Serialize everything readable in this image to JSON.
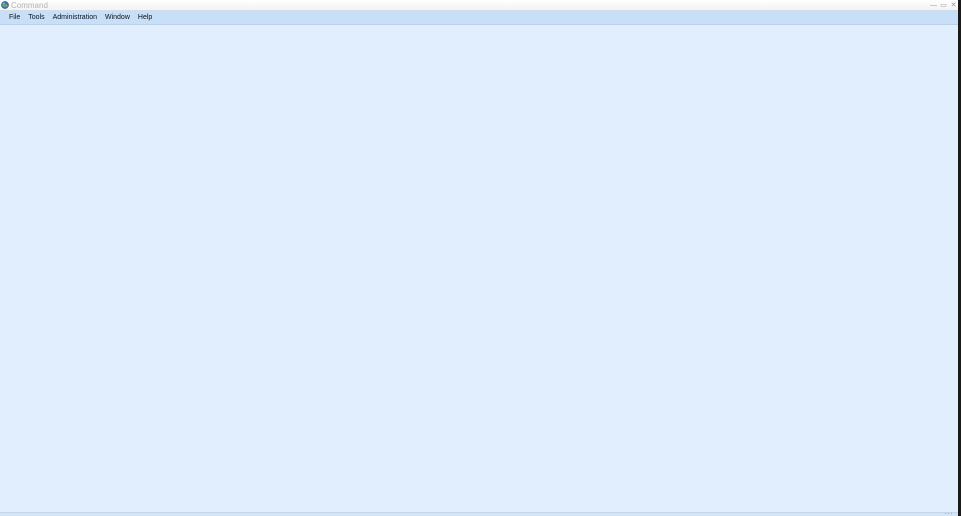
{
  "window": {
    "title": "Command",
    "minimize_glyph": "—",
    "maximize_glyph": "▭",
    "close_glyph": "✕"
  },
  "menu": {
    "items": [
      {
        "id": "file",
        "label": "File"
      },
      {
        "id": "tools",
        "label": "Tools"
      },
      {
        "id": "administration",
        "label": "Administration"
      },
      {
        "id": "window",
        "label": "Window"
      },
      {
        "id": "help",
        "label": "Help"
      }
    ]
  },
  "icons": {
    "app": "globe-icon",
    "grip": "resize-grip-icon"
  },
  "colors": {
    "workspace": "#e1eefe",
    "menubar": "#c8dff9",
    "title_text": "#b3b3b3"
  }
}
